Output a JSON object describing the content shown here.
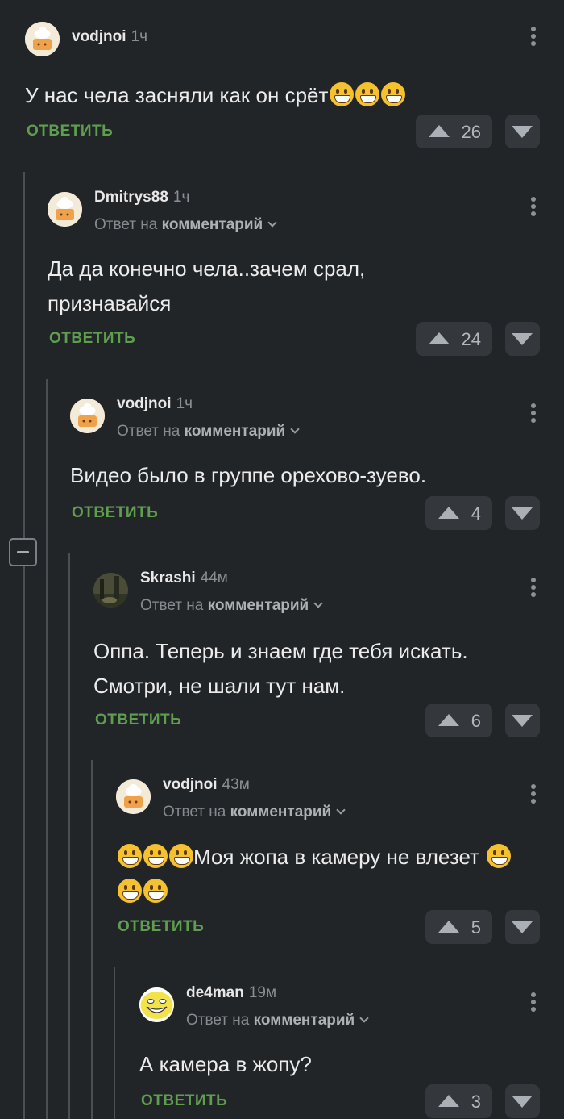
{
  "comments": [
    {
      "username": "vodjnoi",
      "time": "1ч",
      "text_before": "У нас чела засняли как он срёт",
      "text_after": "",
      "emoji_lead": 0,
      "emoji_trail": 3,
      "reply_label": "ОТВЕТИТЬ",
      "votes": "26",
      "avatar": "cake-avatar"
    },
    {
      "username": "Dmitrys88",
      "time": "1ч",
      "reply_prefix": "Ответ на",
      "reply_link": "комментарий",
      "text_before": "Да да конечно чела..зачем срал, признавайся",
      "reply_label": "ОТВЕТИТЬ",
      "votes": "24",
      "avatar": "cake-avatar"
    },
    {
      "username": "vodjnoi",
      "time": "1ч",
      "reply_prefix": "Ответ на",
      "reply_link": "комментарий",
      "text_before": "Видео было в группе орехово-зуево.",
      "reply_label": "ОТВЕТИТЬ",
      "votes": "4",
      "avatar": "cake-avatar"
    },
    {
      "username": "Skrashi",
      "time": "44м",
      "reply_prefix": "Ответ на",
      "reply_link": "комментарий",
      "text_before": "Оппа. Теперь и знаем где тебя искать. Смотри, не шали тут нам.",
      "reply_label": "ОТВЕТИТЬ",
      "votes": "6",
      "avatar": "photo-avatar"
    },
    {
      "username": "vodjnoi",
      "time": "43м",
      "reply_prefix": "Ответ на",
      "reply_link": "комментарий",
      "text_before": "Моя жопа в камеру не влезет",
      "emoji_lead": 3,
      "emoji_trail": 3,
      "reply_label": "ОТВЕТИТЬ",
      "votes": "5",
      "avatar": "cake-avatar"
    },
    {
      "username": "de4man",
      "time": "19м",
      "reply_prefix": "Ответ на",
      "reply_link": "комментарий",
      "text_before": "А камера в жопу?",
      "reply_label": "ОТВЕТИТЬ",
      "votes": "3",
      "avatar": "trollface-avatar"
    }
  ],
  "colors": {
    "background": "#222528",
    "reply_button": "#5f9e4f",
    "vote_box": "#34383c"
  },
  "icons": [
    "upvote-arrow-icon",
    "downvote-arrow-icon",
    "more-vertical-icon",
    "chevron-down-icon",
    "collapse-minus-icon",
    "grinning-emoji-icon"
  ]
}
